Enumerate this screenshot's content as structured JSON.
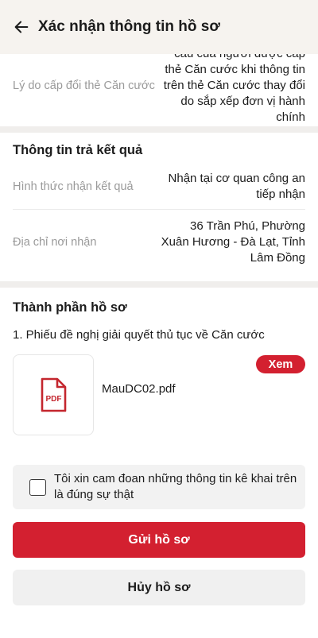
{
  "header": {
    "title": "Xác nhận thông tin hồ sơ"
  },
  "reason": {
    "label": "Lý do cấp đổi thẻ Căn cước",
    "value": "cầu của người được cấp thẻ Căn cước khi thông tin trên thẻ Căn cước thay đổi do sắp xếp đơn vị hành chính"
  },
  "result_section": {
    "title": "Thông tin trả kết quả",
    "method_label": "Hình thức nhận kết quả",
    "method_value": "Nhận tại cơ quan công an tiếp nhận",
    "address_label": "Địa chỉ nơi nhận",
    "address_value": "36 Trần Phú, Phường Xuân Hương - Đà Lạt, Tỉnh Lâm Đồng"
  },
  "documents_section": {
    "title": "Thành phần hồ sơ",
    "items": [
      {
        "label": "1. Phiếu đề nghị giải quyết thủ tục về Căn cước",
        "file_name": "MauDC02.pdf",
        "file_type": "PDF",
        "view_label": "Xem"
      }
    ]
  },
  "commitment": {
    "text": "Tôi xin cam đoan những thông tin kê khai trên là đúng sự thật",
    "checked": false
  },
  "actions": {
    "submit_label": "Gửi hồ sơ",
    "cancel_label": "Hủy hồ sơ"
  },
  "colors": {
    "accent": "#d32030",
    "header_bg": "#f6f3ef",
    "muted_text": "#9a9a9a"
  }
}
